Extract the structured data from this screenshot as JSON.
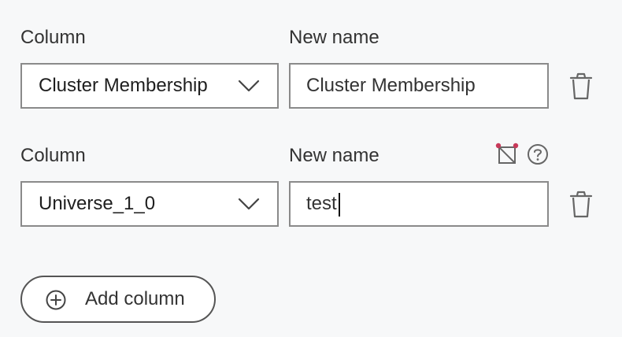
{
  "rows": [
    {
      "column_label": "Column",
      "new_name_label": "New name",
      "column_value": "Cluster Membership",
      "new_name_value": "Cluster Membership"
    },
    {
      "column_label": "Column",
      "new_name_label": "New name",
      "column_value": "Universe_1_0",
      "new_name_value": "test"
    }
  ],
  "add_button": {
    "label": "Add column"
  },
  "icons": {
    "select_chevron": "chevron-down-icon",
    "delete": "trash-icon",
    "mapping": "mapping-icon",
    "help": "help-icon",
    "add": "plus-circle-icon"
  },
  "colors": {
    "background": "#f7f8f9",
    "border": "#8a8a8a",
    "accent_dot": "#c83a5a"
  }
}
